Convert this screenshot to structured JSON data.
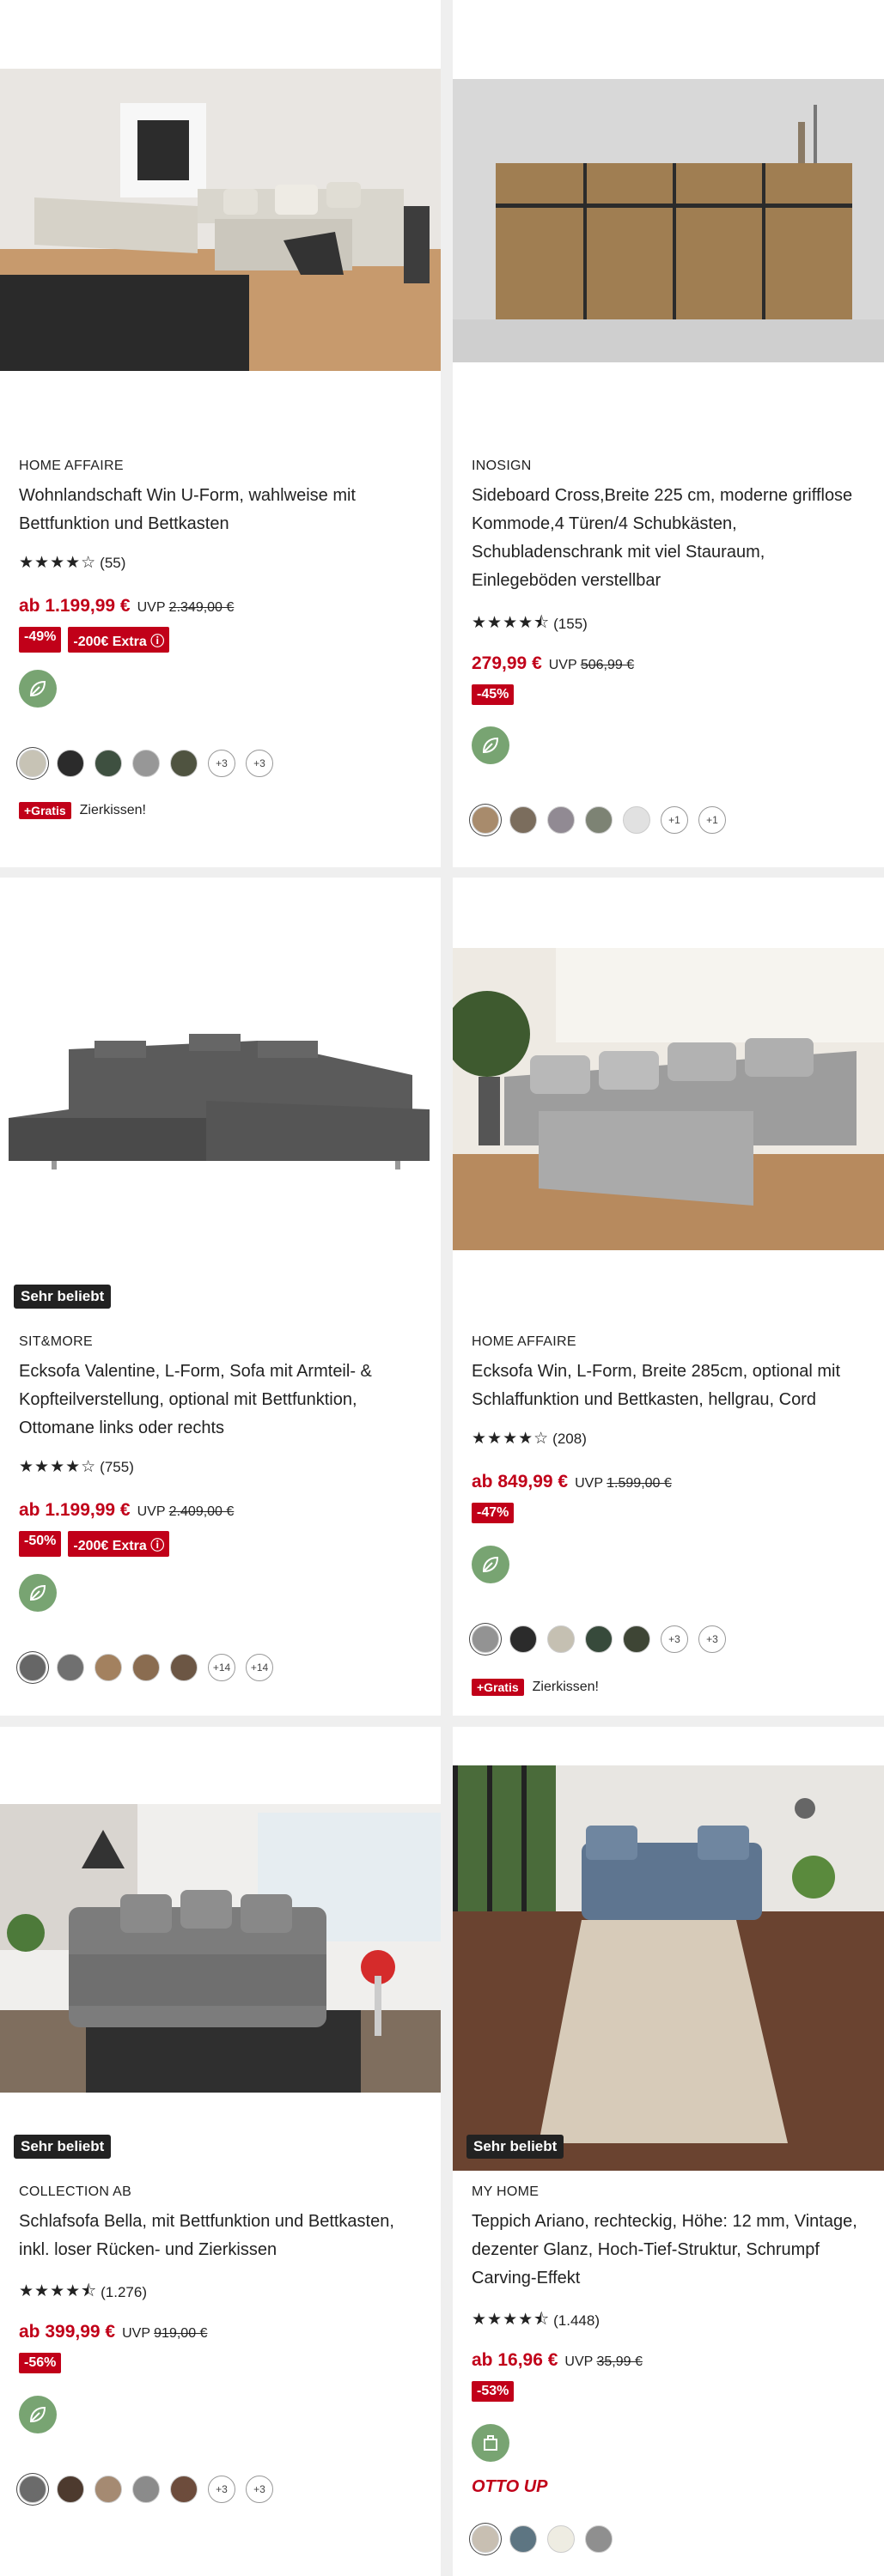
{
  "products": [
    {
      "brand": "HOME AFFAIRE",
      "title": "Wohnlandschaft Win U-Form, wahlweise mit Bettfunktion und Bettkasten",
      "stars": "★★★★☆",
      "reviews": "(55)",
      "price": "ab 1.199,99 €",
      "uvp_label": "UVP",
      "uvp": "2.349,00 €",
      "discounts": [
        "-49%",
        "-200€ Extra ⓘ"
      ],
      "swatches": [
        "#c7c3b5",
        "#2b2b2b",
        "#3e5040",
        "#979797",
        "#4f5340"
      ],
      "more": [
        "+3",
        "+3"
      ],
      "gratis_label": "+Gratis",
      "gratis_text": "Zierkissen!"
    },
    {
      "brand": "INOSIGN",
      "title": "Sideboard Cross,Breite 225 cm, moderne grifflose Kommode,4 Türen/4 Schubkästen, Schubladenschrank mit viel Stauraum, Einlegeböden verstellbar",
      "stars": "★★★★⯪",
      "reviews": "(155)",
      "price": "279,99 €",
      "uvp_label": "UVP",
      "uvp": "506,99 €",
      "discounts": [
        "-45%"
      ],
      "swatches": [
        "#a88b6c",
        "#7b6d5d",
        "#918a93",
        "#7d8374",
        "#e1e1e1"
      ],
      "more": [
        "+1",
        "+1"
      ]
    },
    {
      "badge": "Sehr beliebt",
      "brand": "SIT&MORE",
      "title": "Ecksofa Valentine, L-Form, Sofa mit Armteil- & Kopfteilverstellung, optional mit Bettfunktion, Ottomane links oder rechts",
      "stars": "★★★★☆",
      "reviews": "(755)",
      "price": "ab 1.199,99 €",
      "uvp_label": "UVP",
      "uvp": "2.409,00 €",
      "discounts": [
        "-50%",
        "-200€ Extra ⓘ"
      ],
      "swatches": [
        "#666666",
        "#707070",
        "#a3815f",
        "#8a6c50",
        "#6c5644"
      ],
      "more": [
        "+14",
        "+14"
      ]
    },
    {
      "brand": "HOME AFFAIRE",
      "title": "Ecksofa Win, L-Form, Breite 285cm, optional mit Schlaffunktion und Bettkasten, hellgrau, Cord",
      "stars": "★★★★☆",
      "reviews": "(208)",
      "price": "ab 849,99 €",
      "uvp_label": "UVP",
      "uvp": "1.599,00 €",
      "discounts": [
        "-47%"
      ],
      "swatches": [
        "#939393",
        "#2b2b2b",
        "#c5c0b2",
        "#374a3b",
        "#3e4535"
      ],
      "more": [
        "+3",
        "+3"
      ],
      "gratis_label": "+Gratis",
      "gratis_text": "Zierkissen!"
    },
    {
      "badge": "Sehr beliebt",
      "brand": "COLLECTION AB",
      "title": "Schlafsofa Bella, mit Bettfunktion und Bettkasten, inkl. loser Rücken- und Zierkissen",
      "stars": "★★★★⯪",
      "reviews": "(1.276)",
      "price": "ab 399,99 €",
      "uvp_label": "UVP",
      "uvp": "919,00 €",
      "discounts": [
        "-56%"
      ],
      "swatches": [
        "#6b6b6b",
        "#4d3a2e",
        "#a58a72",
        "#8b8b8b",
        "#6d4c3c"
      ],
      "more": [
        "+3",
        "+3"
      ]
    },
    {
      "badge": "Sehr beliebt",
      "brand": "MY HOME",
      "title": "Teppich Ariano, rechteckig, Höhe: 12 mm, Vintage, dezenter Glanz, Hoch-Tief-Struktur, Schrumpf Carving-Effekt",
      "stars": "★★★★⯪",
      "reviews": "(1.448)",
      "price": "ab 16,96 €",
      "uvp_label": "UVP",
      "uvp": "35,99 €",
      "discounts": [
        "-53%"
      ],
      "logo": "OTTO UP",
      "swatches": [
        "#c8bfb2",
        "#5d7582",
        "#eeece2",
        "#8f8f8f"
      ]
    }
  ]
}
